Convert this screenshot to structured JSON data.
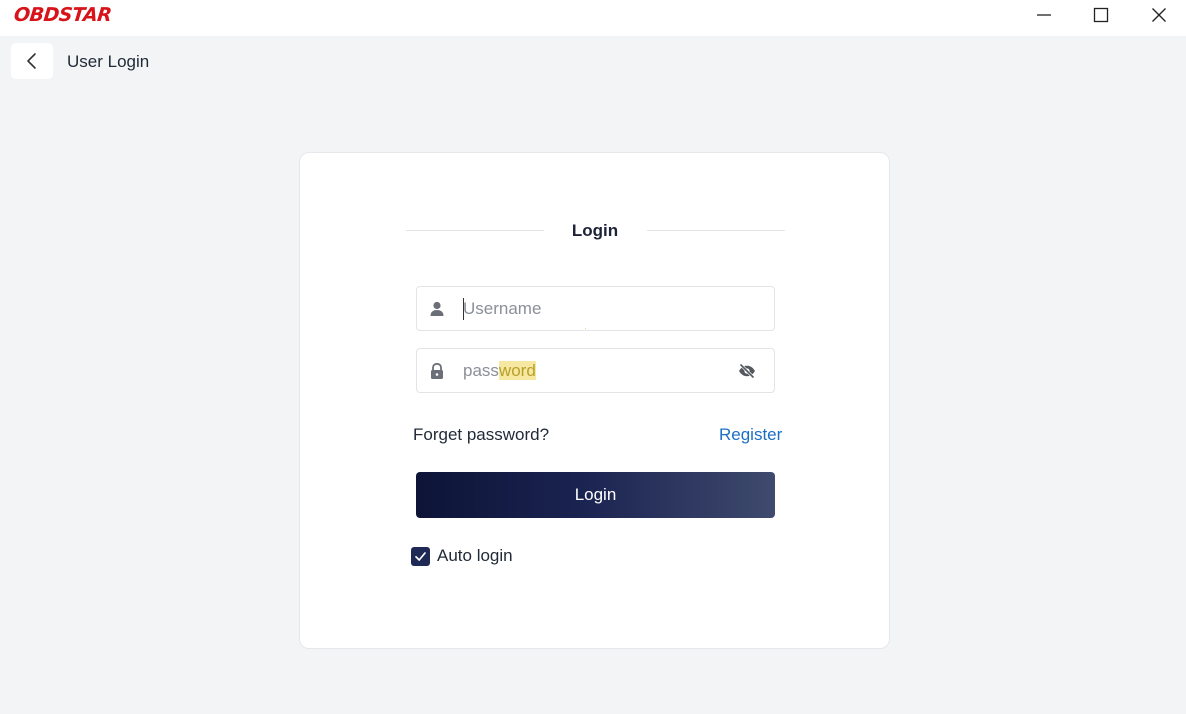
{
  "app": {
    "logo_text": "OBDSTAR",
    "logo_color": "#d7141a"
  },
  "window_controls": {
    "minimize": "minimize-icon",
    "maximize": "maximize-icon",
    "close": "close-icon"
  },
  "header": {
    "back_icon": "chevron-left-icon",
    "title": "User Login"
  },
  "login_form": {
    "heading": "Login",
    "username": {
      "icon": "user-icon",
      "value": "",
      "placeholder": "Username"
    },
    "password": {
      "icon": "lock-icon",
      "placeholder_part1": "pass",
      "placeholder_part2": "word",
      "value": "",
      "toggle_icon": "eye-off-icon"
    },
    "forget_password": "Forget password?",
    "register": "Register",
    "login_button": "Login",
    "auto_login": {
      "label": "Auto login",
      "checked": true
    }
  },
  "colors": {
    "accent_dark": "#0d1437",
    "link": "#1d6fc4",
    "background": "#f3f4f6"
  }
}
